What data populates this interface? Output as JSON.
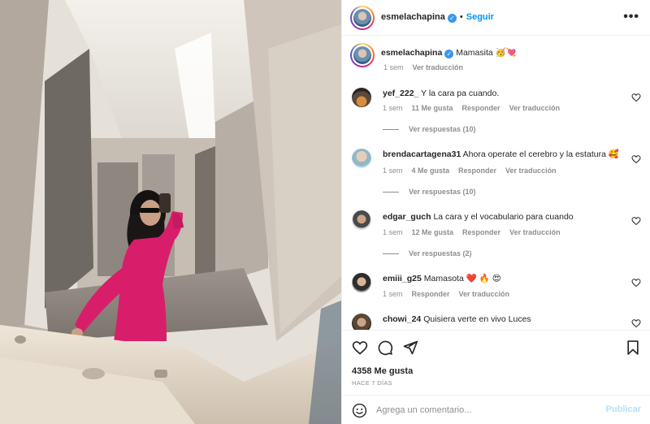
{
  "header": {
    "username": "esmelachapina",
    "follow_label": "Seguir",
    "separator": "•",
    "more_label": "•••"
  },
  "caption": {
    "username": "esmelachapina",
    "text": "Mamasita 🥳💘",
    "time": "1 sem",
    "translate": "Ver traducción"
  },
  "comments": [
    {
      "username": "yef_222_",
      "text": "Y la cara pa cuando.",
      "time": "1 sem",
      "likes": "11 Me gusta",
      "reply": "Responder",
      "translate": "Ver traducción",
      "replies": "Ver respuestas (10)"
    },
    {
      "username": "brendacartagena31",
      "text": "Ahora operate el cerebro y la estatura 🥰",
      "time": "1 sem",
      "likes": "4 Me gusta",
      "reply": "Responder",
      "translate": "Ver traducción",
      "replies": "Ver respuestas (10)"
    },
    {
      "username": "edgar_guch",
      "text": "La cara y el vocabulario para cuando",
      "time": "1 sem",
      "likes": "12 Me gusta",
      "reply": "Responder",
      "translate": "Ver traducción",
      "replies": "Ver respuestas (2)"
    },
    {
      "username": "emiii_g25",
      "text": "Mamasota ❤️ 🔥 😍",
      "time": "1 sem",
      "reply": "Responder",
      "translate": "Ver traducción"
    },
    {
      "username": "chowi_24",
      "text": "Quisiera verte en vivo Luces"
    }
  ],
  "footer": {
    "likes": "4358 Me gusta",
    "ago": "HACE 7 DÍAS",
    "comment_placeholder": "Agrega un comentario...",
    "post_label": "Publicar"
  },
  "icons": {
    "verified": "verified-badge-icon",
    "heart": "heart-outline-icon",
    "comment": "speech-bubble-icon",
    "share": "paper-plane-icon",
    "save": "bookmark-icon",
    "emoji": "smiley-icon"
  },
  "colors": {
    "link_blue": "#0095f6",
    "verified_blue": "#3897f0",
    "muted_text": "#8e8e8e",
    "post_disabled": "#b2dffc",
    "dress_pink": "#d81e6a"
  }
}
